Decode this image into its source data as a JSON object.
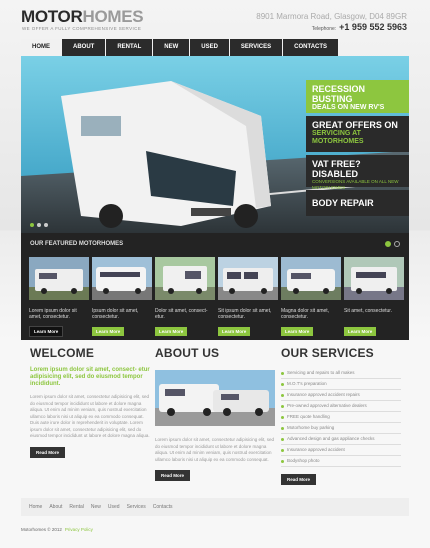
{
  "brand": {
    "part1": "MOTOR",
    "part2": "HOMES",
    "tagline": "WE OFFER A FULLY COMPREHENSIVE SERVICE"
  },
  "contact": {
    "address": "8901 Marmora Road, Glasgow, D04 89GR",
    "phone_label": "Telephone:",
    "phone": "+1 959 552 5963"
  },
  "nav": [
    "HOME",
    "ABOUT",
    "RENTAL",
    "NEW",
    "USED",
    "SERVICES",
    "CONTACTS"
  ],
  "hero": {
    "promos": [
      {
        "t1": "RECESSION BUSTING",
        "t2": "DEALS ON NEW RV'S"
      },
      {
        "t1": "GREAT OFFERS ON",
        "t2": "SERVICING AT MOTORHOMES"
      },
      {
        "t1": "VAT FREE? DISABLED",
        "sm": "CONVERSIONS AVAILABLE ON ALL NEW MOTORHOMES"
      },
      {
        "t1": "BODY REPAIR"
      }
    ]
  },
  "featured": {
    "title": "OUR FEATURED MOTORHOMES",
    "items": [
      {
        "caption": "Lorem ipsum dolor sit amet, consectetur.",
        "button": "Learn More"
      },
      {
        "caption": "Ipsum dolor sit amet, consectetur.",
        "button": "Learn More"
      },
      {
        "caption": "Dolor sit amet, consect- etur.",
        "button": "Learn More"
      },
      {
        "caption": "Sit ipsum dolor sit amet, consectetur.",
        "button": "Learn More"
      },
      {
        "caption": "Magna dolor sit amet, consectetur.",
        "button": "Learn More"
      },
      {
        "caption": "Sit amet, consectetur.",
        "button": "Learn More"
      }
    ]
  },
  "welcome": {
    "title": "WELCOME",
    "lead": "Lorem ipsum dolor sit amet, consect- etur adipisicing elit, sed do eiusmod tempor incididunt.",
    "body": "Lorem ipsum dolor sit amet, consectetur adipisicing elit, sed do eiusmod tempor incididunt ut labore et dolore magna aliqua. Ut enim ad minim veniam, quis nostrud exercitation ullamco laboris nisi ut aliquip ex ea commodo consequat. Duis aute irure dolor in reprehenderit in voluptate. Lorem ipsum dolor sit amet, consectetur adipisicing elit, sed do eiusmod tempor incididunt ut labore et dolore magna aliqua.",
    "button": "Read More"
  },
  "about": {
    "title": "ABOUT US",
    "body": "Lorem ipsum dolor sit amet, consectetur adipisicing elit, sed do eiusmod tempor incididunt ut labore et dolore magna aliqua. Ut enim ad minim veniam, quis nostrud exercitation ullamco laboris nisi ut aliquip ex ea commodo consequat.",
    "button": "Read More"
  },
  "services": {
    "title": "OUR SERVICES",
    "items": [
      "Servicing and repairs to all makes",
      "M.O.T's preparation",
      "Insurance approved accident repairs",
      "Pre-owned approved alternative dealers",
      "FREE quote handling",
      "Motorhome buy parking",
      "Advanced design and gas appliance checks",
      "Insurance approved accident",
      "Bodyshop photo"
    ],
    "button": "Read More"
  },
  "footer": {
    "links": [
      "Home",
      "About",
      "Rental",
      "New",
      "Used",
      "Services",
      "Contacts"
    ],
    "copyright": "Motorhomes © 2012",
    "privacy": "Privacy Policy"
  }
}
